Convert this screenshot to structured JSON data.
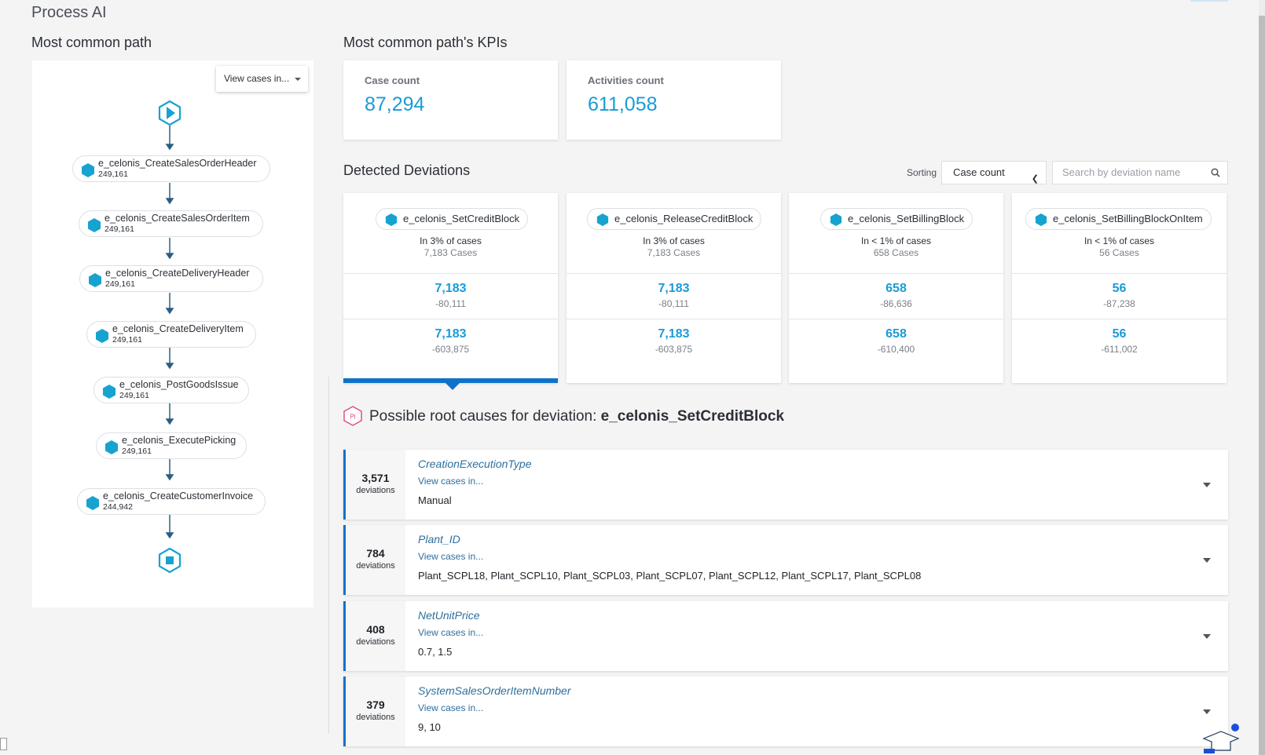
{
  "app": {
    "title": "Process AI"
  },
  "left_panel": {
    "title": "Most common path",
    "view_cases_label": "View cases in...",
    "nodes": [
      {
        "label": "e_celonis_CreateSalesOrderHeader",
        "count": "249,161"
      },
      {
        "label": "e_celonis_CreateSalesOrderItem",
        "count": "249,161"
      },
      {
        "label": "e_celonis_CreateDeliveryHeader",
        "count": "249,161"
      },
      {
        "label": "e_celonis_CreateDeliveryItem",
        "count": "249,161"
      },
      {
        "label": "e_celonis_PostGoodsIssue",
        "count": "249,161"
      },
      {
        "label": "e_celonis_ExecutePicking",
        "count": "249,161"
      },
      {
        "label": "e_celonis_CreateCustomerInvoice",
        "count": "244,942"
      }
    ]
  },
  "kpis": {
    "title": "Most common path's KPIs",
    "cards": [
      {
        "label": "Case count",
        "value": "87,294"
      },
      {
        "label": "Activities count",
        "value": "611,058"
      }
    ]
  },
  "deviations": {
    "title": "Detected Deviations",
    "sorting_label": "Sorting",
    "sorting_value": "Case count",
    "search_placeholder": "Search by deviation name",
    "cards": [
      {
        "name": "e_celonis_SetCreditBlock",
        "share": "In 3% of cases",
        "cases": "7,183 Cases",
        "m1": "7,183",
        "m1_sub": "-80,111",
        "m2": "7,183",
        "m2_sub": "-603,875"
      },
      {
        "name": "e_celonis_ReleaseCreditBlock",
        "share": "In 3% of cases",
        "cases": "7,183 Cases",
        "m1": "7,183",
        "m1_sub": "-80,111",
        "m2": "7,183",
        "m2_sub": "-603,875"
      },
      {
        "name": "e_celonis_SetBillingBlock",
        "share": "In < 1% of cases",
        "cases": "658 Cases",
        "m1": "658",
        "m1_sub": "-86,636",
        "m2": "658",
        "m2_sub": "-610,400"
      },
      {
        "name": "e_celonis_SetBillingBlockOnItem",
        "share": "In < 1% of cases",
        "cases": "56 Cases",
        "m1": "56",
        "m1_sub": "-87,238",
        "m2": "56",
        "m2_sub": "-611,002"
      }
    ]
  },
  "root_causes": {
    "badge": "PI",
    "title_prefix": "Possible root causes for deviation:",
    "title_deviation": "e_celonis_SetCreditBlock",
    "rows": [
      {
        "count": "3,571",
        "unit": "deviations",
        "attribute": "CreationExecutionType",
        "link": "View cases in...",
        "values": "Manual"
      },
      {
        "count": "784",
        "unit": "deviations",
        "attribute": "Plant_ID",
        "link": "View cases in...",
        "values": "Plant_SCPL18, Plant_SCPL10, Plant_SCPL03, Plant_SCPL07, Plant_SCPL12, Plant_SCPL17, Plant_SCPL08"
      },
      {
        "count": "408",
        "unit": "deviations",
        "attribute": "NetUnitPrice",
        "link": "View cases in...",
        "values": "0.7, 1.5"
      },
      {
        "count": "379",
        "unit": "deviations",
        "attribute": "SystemSalesOrderItemNumber",
        "link": "View cases in...",
        "values": "9, 10"
      }
    ]
  },
  "colors": {
    "accent": "#1a9bd7",
    "selected": "#0e72c9",
    "node": "#16a3d0"
  },
  "icons": [
    "play-icon",
    "stop-icon",
    "hexagon-icon",
    "search-icon",
    "chevron-down-icon",
    "process-ai-icon",
    "academy-icon"
  ]
}
